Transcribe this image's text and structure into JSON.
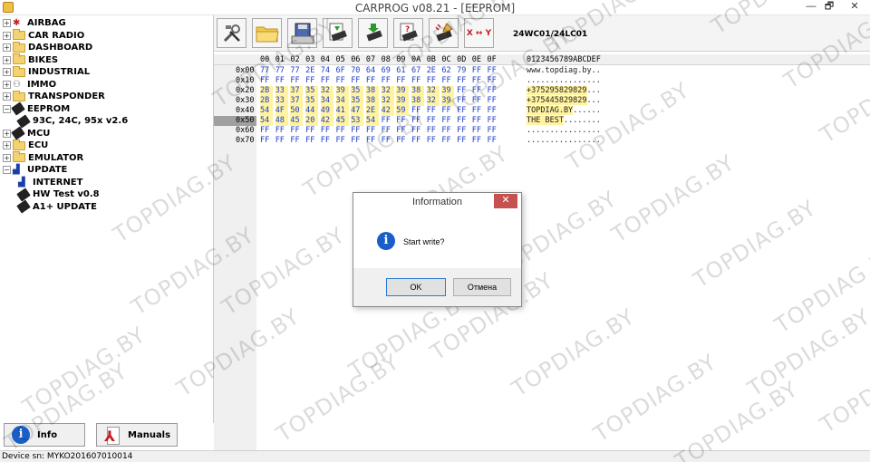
{
  "window": {
    "title": "CARPROG   v08.21 - [EEPROM]",
    "min_glyph": "—",
    "max_glyph": "🗗",
    "close_glyph": "✕"
  },
  "tree": [
    {
      "label": "AIRBAG",
      "icon": "red-figure-icon",
      "expander": "+"
    },
    {
      "label": "CAR RADIO",
      "icon": "folder-icon",
      "expander": "+"
    },
    {
      "label": "DASHBOARD",
      "icon": "folder-icon",
      "expander": "+"
    },
    {
      "label": "BIKES",
      "icon": "folder-icon",
      "expander": "+"
    },
    {
      "label": "INDUSTRIAL",
      "icon": "folder-icon",
      "expander": "+"
    },
    {
      "label": "IMMO",
      "icon": "person-icon",
      "expander": "+"
    },
    {
      "label": "TRANSPONDER",
      "icon": "folder-icon",
      "expander": "+"
    },
    {
      "label": "EEPROM",
      "icon": "chip-icon",
      "expander": "−"
    },
    {
      "label": "93C, 24C, 95x v2.6",
      "icon": "chip-icon",
      "expander": "",
      "child": true
    },
    {
      "label": "MCU",
      "icon": "chip-icon",
      "expander": "+"
    },
    {
      "label": "ECU",
      "icon": "folder-icon",
      "expander": "+"
    },
    {
      "label": "EMULATOR",
      "icon": "folder-icon",
      "expander": "+"
    },
    {
      "label": "UPDATE",
      "icon": "update-icon",
      "expander": "−"
    },
    {
      "label": "INTERNET",
      "icon": "update-icon",
      "expander": "",
      "child": true
    },
    {
      "label": "HW Test v0.8",
      "icon": "chip-icon",
      "expander": "",
      "child": true
    },
    {
      "label": "A1+ UPDATE",
      "icon": "chip-icon",
      "expander": "",
      "child": true
    }
  ],
  "bottom": {
    "info_label": "Info",
    "manuals_label": "Manuals"
  },
  "status": {
    "device": "Device sn: MYKO201607010014"
  },
  "toolbar": {
    "swap_label": "X ↔ Y",
    "chip_label": "24WC01/24LC01"
  },
  "hex": {
    "columns": [
      "00",
      "01",
      "02",
      "03",
      "04",
      "05",
      "06",
      "07",
      "08",
      "09",
      "0A",
      "0B",
      "0C",
      "0D",
      "0E",
      "0F"
    ],
    "ascii_header": "0123456789ABCDEF",
    "rows": [
      {
        "addr": "0x00",
        "bytes": [
          "77",
          "77",
          "77",
          "2E",
          "74",
          "6F",
          "70",
          "64",
          "69",
          "61",
          "67",
          "2E",
          "62",
          "79",
          "FF",
          "FF"
        ],
        "ascii": "www.topdiag.by.."
      },
      {
        "addr": "0x10",
        "bytes": [
          "FF",
          "FF",
          "FF",
          "FF",
          "FF",
          "FF",
          "FF",
          "FF",
          "FF",
          "FF",
          "FF",
          "FF",
          "FF",
          "FF",
          "FF",
          "FF"
        ],
        "ascii": "................"
      },
      {
        "addr": "0x20",
        "bytes": [
          "2B",
          "33",
          "37",
          "35",
          "32",
          "39",
          "35",
          "38",
          "32",
          "39",
          "38",
          "32",
          "39",
          "FF",
          "FF",
          "FF"
        ],
        "ascii": "+375295829829...",
        "hl": 13
      },
      {
        "addr": "0x30",
        "bytes": [
          "2B",
          "33",
          "37",
          "35",
          "34",
          "34",
          "35",
          "38",
          "32",
          "39",
          "38",
          "32",
          "39",
          "FF",
          "FF",
          "FF"
        ],
        "ascii": "+375445829829...",
        "hl": 13
      },
      {
        "addr": "0x40",
        "bytes": [
          "54",
          "4F",
          "50",
          "44",
          "49",
          "41",
          "47",
          "2E",
          "42",
          "59",
          "FF",
          "FF",
          "FF",
          "FF",
          "FF",
          "FF"
        ],
        "ascii": "TOPDIAG.BY......",
        "hl": 10
      },
      {
        "addr": "0x50",
        "bytes": [
          "54",
          "48",
          "45",
          "20",
          "42",
          "45",
          "53",
          "54",
          "FF",
          "FF",
          "FF",
          "FF",
          "FF",
          "FF",
          "FF",
          "FF"
        ],
        "ascii": "THE BEST........",
        "hl": 8,
        "selected": true
      },
      {
        "addr": "0x60",
        "bytes": [
          "FF",
          "FF",
          "FF",
          "FF",
          "FF",
          "FF",
          "FF",
          "FF",
          "FF",
          "FF",
          "FF",
          "FF",
          "FF",
          "FF",
          "FF",
          "FF"
        ],
        "ascii": "................"
      },
      {
        "addr": "0x70",
        "bytes": [
          "FF",
          "FF",
          "FF",
          "FF",
          "FF",
          "FF",
          "FF",
          "FF",
          "FF",
          "FF",
          "FF",
          "FF",
          "FF",
          "FF",
          "FF",
          "FF"
        ],
        "ascii": "................"
      }
    ]
  },
  "dialog": {
    "title": "Information",
    "message": "Start write?",
    "ok_label": "OK",
    "cancel_label": "Отмена",
    "close_glyph": "✕",
    "info_glyph": "i"
  },
  "watermark": "TOPDIAG.BY"
}
